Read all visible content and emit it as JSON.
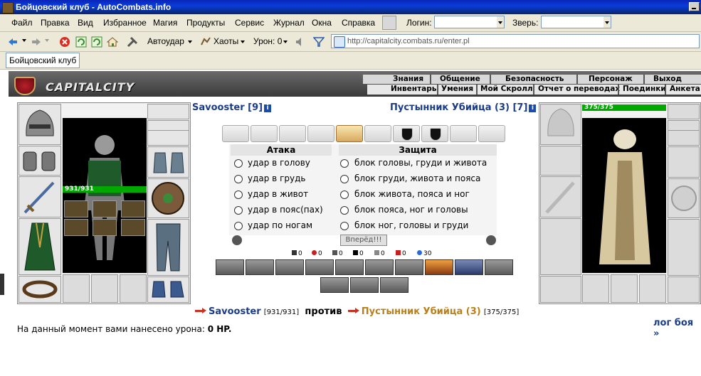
{
  "window": {
    "title": "Бойцовский клуб - AutoCombats.info"
  },
  "menu": {
    "items": [
      "Файл",
      "Правка",
      "Вид",
      "Избранное",
      "Магия",
      "Продукты",
      "Сервис",
      "Журнал",
      "Окна",
      "Справка"
    ],
    "login_label": "Логин:",
    "beast_label": "Зверь:"
  },
  "toolbar": {
    "autohit": "Автоудар",
    "chaos": "Хаоты",
    "damage": "Урон: 0",
    "address": "http://capitalcity.combats.ru/enter.pl"
  },
  "tabs": {
    "active": "Бойцовский клуб"
  },
  "game": {
    "logo": "CAPITALCITY",
    "nav_top": [
      "Знания",
      "Общение",
      "Безопасность",
      "Персонаж",
      "Выход"
    ],
    "nav_bottom": [
      "Инвентарь",
      "Умения",
      "Мой Скролл",
      "Отчет о переводах",
      "Поединки",
      "Анкета"
    ]
  },
  "player": {
    "name": "Savooster [9]",
    "short": "Savooster",
    "hp": "931/931",
    "hp_bracket": "[931/931]"
  },
  "enemy": {
    "name": "Пустынник Убийца (3) [7]",
    "short": "Пустынник Убийца (3)",
    "hp": "375/375",
    "hp_bracket": "[375/375]"
  },
  "combat": {
    "attack_title": "Атака",
    "defense_title": "Защита",
    "attacks": [
      "удар в голову",
      "удар в грудь",
      "удар в живот",
      "удар в пояс(пах)",
      "удар по ногам"
    ],
    "defenses": [
      "блок головы, груди и живота",
      "блок груди, живота и пояса",
      "блок живота, пояса и ног",
      "блок пояса, ног и головы",
      "блок ног, головы и груди"
    ],
    "go_button": "Вперёд!!!",
    "counters": [
      "0",
      "0",
      "0",
      "0",
      "0",
      "0",
      "30"
    ],
    "vs": "против",
    "damage_text": "На данный момент вами нанесено урона:",
    "damage_value": "0 HP.",
    "log_link": "лог боя »"
  }
}
